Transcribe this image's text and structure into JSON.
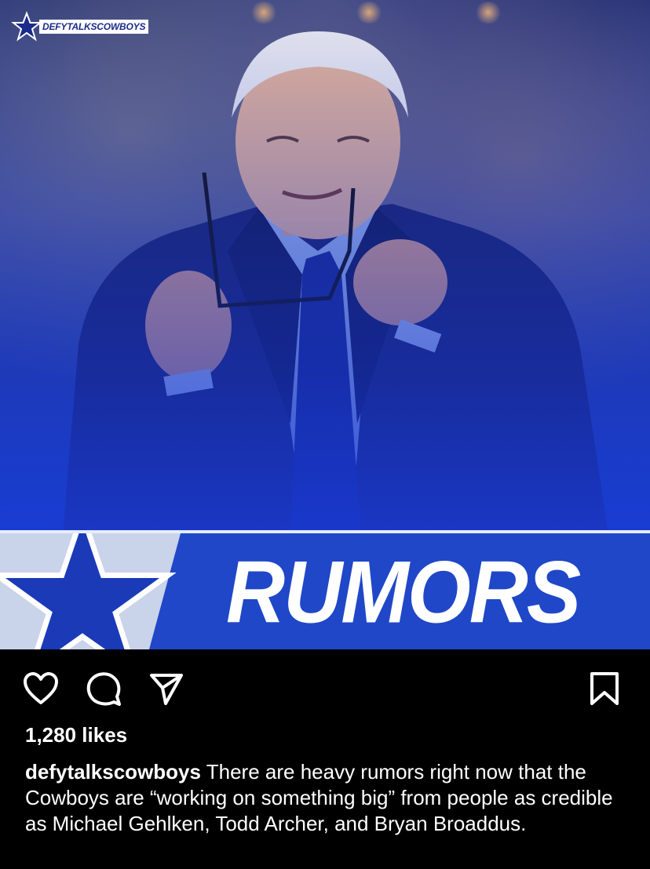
{
  "post": {
    "brand_watermark": "DEFYTALKSCOWBOYS",
    "banner_text": "RUMORS"
  },
  "actions": {
    "like_icon": "heart-icon",
    "comment_icon": "comment-icon",
    "share_icon": "send-icon",
    "save_icon": "bookmark-icon"
  },
  "likes": "1,280 likes",
  "caption": {
    "username": "defytalkscowboys",
    "text": "There are heavy rumors right now that the Cowboys are “working on something big” from people as credible as Michael Gehlken, Todd Archer, and Bryan Broaddus."
  },
  "colors": {
    "banner_blue": "#1f47c8",
    "background": "#000000",
    "text": "#ffffff"
  }
}
